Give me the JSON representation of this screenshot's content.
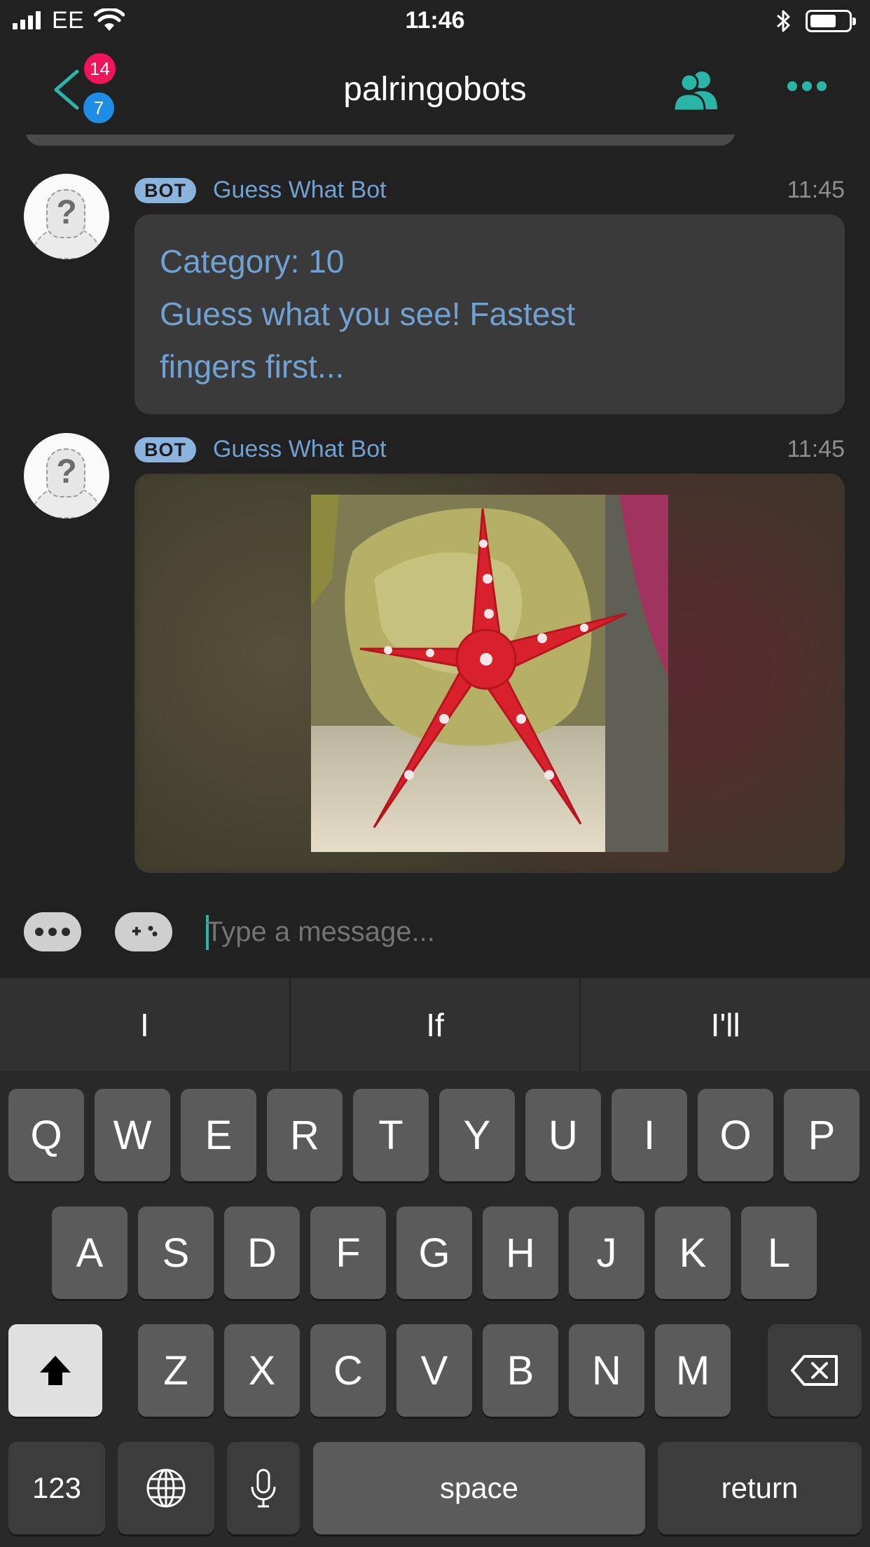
{
  "status_bar": {
    "carrier": "EE",
    "time": "11:46"
  },
  "nav": {
    "title": "palringobots",
    "badges": {
      "pink": "14",
      "blue": "7"
    }
  },
  "messages": [
    {
      "tag": "BOT",
      "sender": "Guess What Bot",
      "time": "11:45",
      "lines": [
        "Category: 10",
        "Guess what you see! Fastest",
        "fingers first..."
      ]
    },
    {
      "tag": "BOT",
      "sender": "Guess What Bot",
      "time": "11:45",
      "image": "starfish-photo"
    }
  ],
  "composer": {
    "placeholder": "Type a message..."
  },
  "keyboard": {
    "suggestions": [
      "I",
      "If",
      "I'll"
    ],
    "row1": [
      "Q",
      "W",
      "E",
      "R",
      "T",
      "Y",
      "U",
      "I",
      "O",
      "P"
    ],
    "row2": [
      "A",
      "S",
      "D",
      "F",
      "G",
      "H",
      "J",
      "K",
      "L"
    ],
    "row3": [
      "Z",
      "X",
      "C",
      "V",
      "B",
      "N",
      "M"
    ],
    "numbers_label": "123",
    "space_label": "space",
    "return_label": "return"
  },
  "colors": {
    "accent": "#2bb5a6",
    "link": "#6fa2d3",
    "badge_pink": "#f0145a",
    "badge_blue": "#1e8de6"
  }
}
